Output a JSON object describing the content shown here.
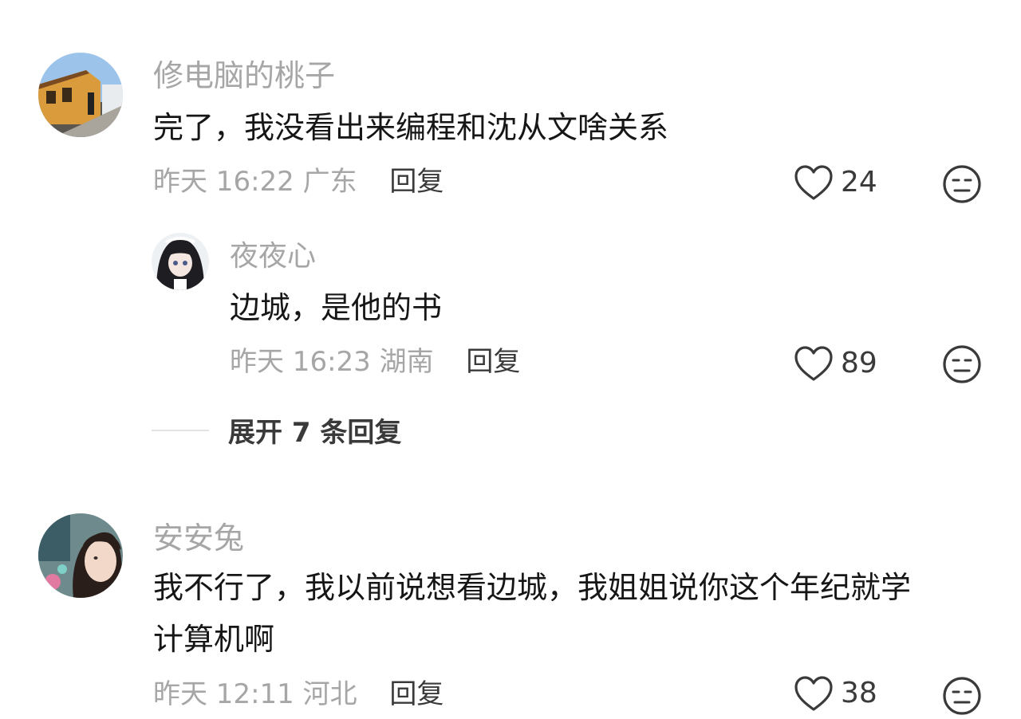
{
  "comments": [
    {
      "username": "修电脑的桃子",
      "text": "完了，我没看出来编程和沈从文啥关系",
      "time": "昨天 16:22",
      "location": "广东",
      "reply_label": "回复",
      "likes": "24"
    },
    {
      "username": "夜夜心",
      "text": "边城，是他的书",
      "time": "昨天 16:23",
      "location": "湖南",
      "reply_label": "回复",
      "likes": "89"
    },
    {
      "username": "安安兔",
      "text_line1": "我不行了，我以前说想看边城，我姐姐说你这个年纪就学",
      "text_line2": "计算机啊",
      "time": "昨天 12:11",
      "location": "河北",
      "reply_label": "回复",
      "likes": "38"
    }
  ],
  "expand_replies": "展开 7 条回复",
  "icons": {
    "like": "heart-outline-icon",
    "dislike": "neutral-face-icon"
  },
  "colors": {
    "username": "#a6a6a6",
    "text": "#161616",
    "meta": "#a6a6a6",
    "action": "#3a3a3a"
  }
}
